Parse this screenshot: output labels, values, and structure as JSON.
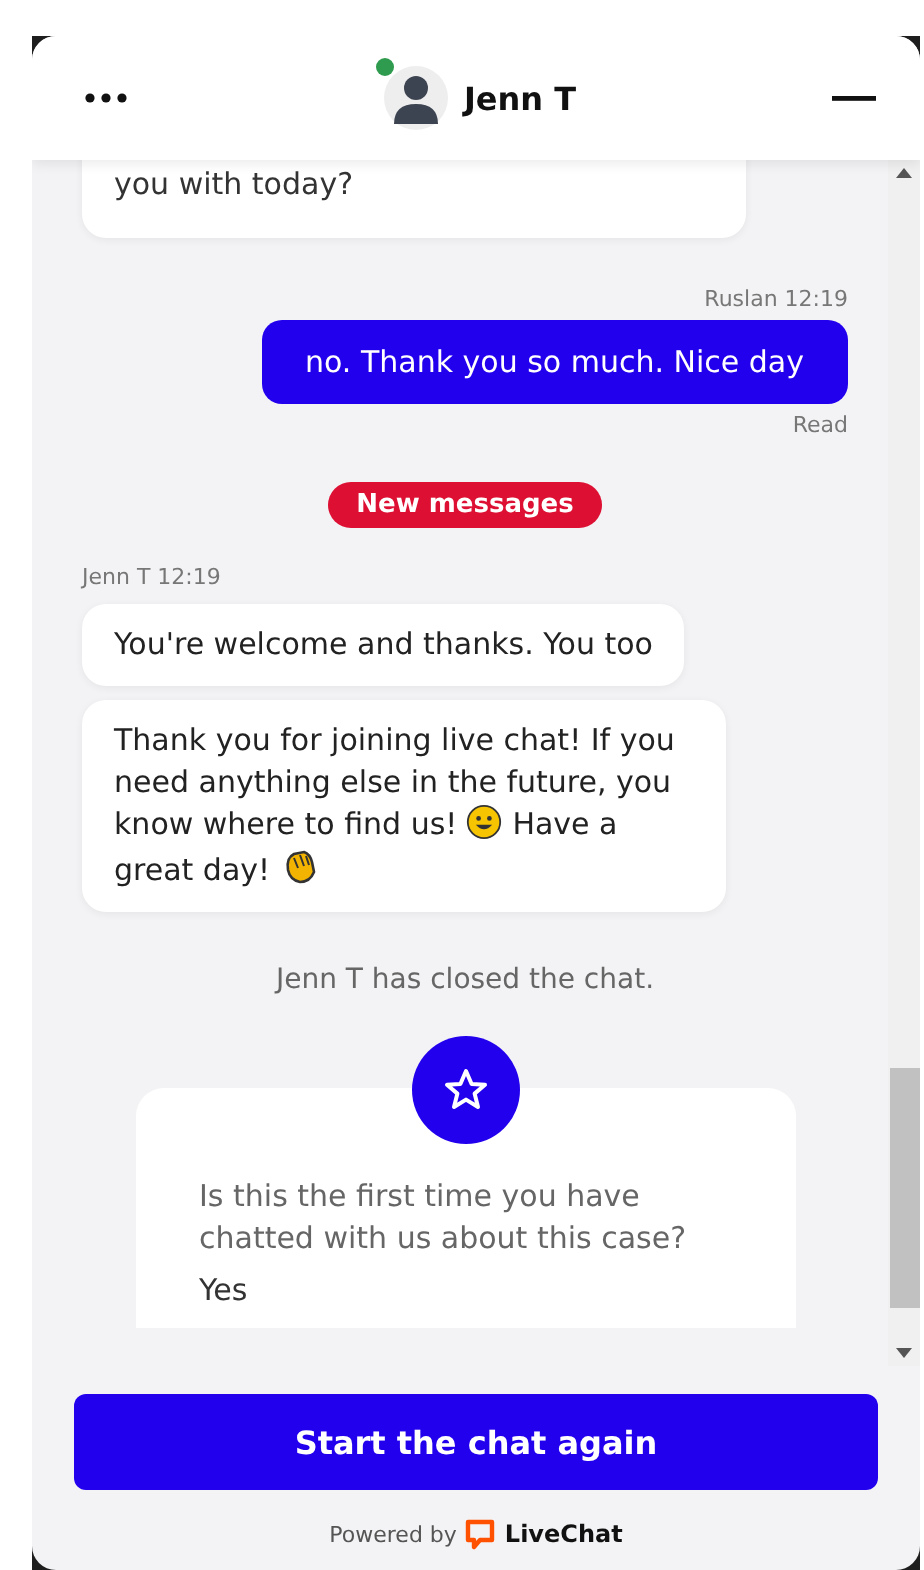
{
  "header": {
    "agent_name": "Jenn T",
    "online": true
  },
  "messages": [
    {
      "kind": "agent-bubble",
      "text": "you with today?"
    },
    {
      "kind": "visitor-bubble",
      "meta": "Ruslan 12:19",
      "text": "no. Thank you so much. Nice day",
      "status": "Read"
    },
    {
      "kind": "divider-pill",
      "text": "New messages"
    },
    {
      "kind": "agent-group",
      "meta": "Jenn T 12:19",
      "bubbles": [
        {
          "parts": [
            {
              "kind": "text",
              "text": "You're welcome and thanks. You too"
            }
          ]
        },
        {
          "parts": [
            {
              "kind": "text",
              "text": "Thank you for joining live chat! If you need anything else in the future, you know where to find us! "
            },
            {
              "kind": "smiley-emoji"
            },
            {
              "kind": "text",
              "text": " Have a great day! "
            },
            {
              "kind": "waving-hand-emoji"
            }
          ]
        }
      ]
    },
    {
      "kind": "system-note",
      "text": "Jenn T has closed the chat."
    },
    {
      "kind": "survey",
      "question": "Is this the first time you have chatted with us about this case?",
      "answer": "Yes"
    }
  ],
  "action_button": "Start the chat again",
  "footer": {
    "prefix": "Powered by",
    "brand": "LiveChat"
  }
}
